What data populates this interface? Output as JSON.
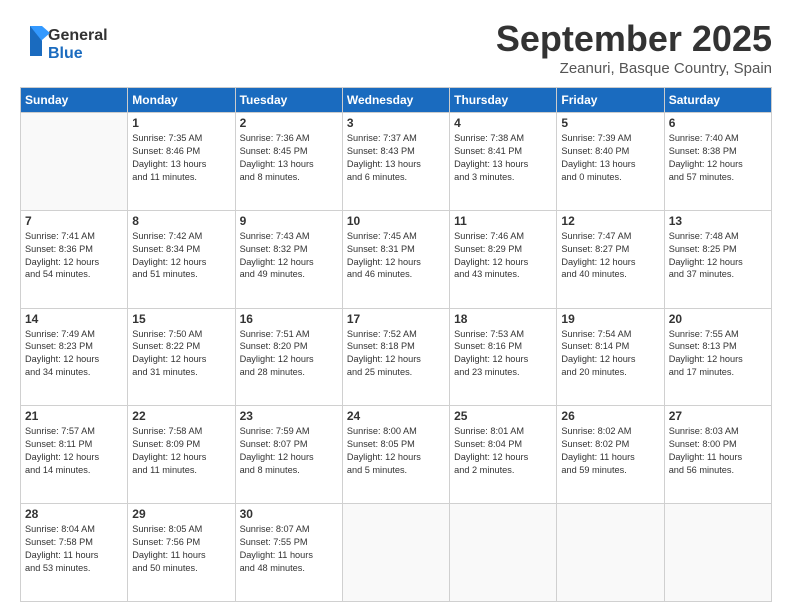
{
  "header": {
    "logo_general": "General",
    "logo_blue": "Blue",
    "month": "September 2025",
    "location": "Zeanuri, Basque Country, Spain"
  },
  "weekdays": [
    "Sunday",
    "Monday",
    "Tuesday",
    "Wednesday",
    "Thursday",
    "Friday",
    "Saturday"
  ],
  "weeks": [
    [
      {
        "day": "",
        "info": ""
      },
      {
        "day": "1",
        "info": "Sunrise: 7:35 AM\nSunset: 8:46 PM\nDaylight: 13 hours\nand 11 minutes."
      },
      {
        "day": "2",
        "info": "Sunrise: 7:36 AM\nSunset: 8:45 PM\nDaylight: 13 hours\nand 8 minutes."
      },
      {
        "day": "3",
        "info": "Sunrise: 7:37 AM\nSunset: 8:43 PM\nDaylight: 13 hours\nand 6 minutes."
      },
      {
        "day": "4",
        "info": "Sunrise: 7:38 AM\nSunset: 8:41 PM\nDaylight: 13 hours\nand 3 minutes."
      },
      {
        "day": "5",
        "info": "Sunrise: 7:39 AM\nSunset: 8:40 PM\nDaylight: 13 hours\nand 0 minutes."
      },
      {
        "day": "6",
        "info": "Sunrise: 7:40 AM\nSunset: 8:38 PM\nDaylight: 12 hours\nand 57 minutes."
      }
    ],
    [
      {
        "day": "7",
        "info": "Sunrise: 7:41 AM\nSunset: 8:36 PM\nDaylight: 12 hours\nand 54 minutes."
      },
      {
        "day": "8",
        "info": "Sunrise: 7:42 AM\nSunset: 8:34 PM\nDaylight: 12 hours\nand 51 minutes."
      },
      {
        "day": "9",
        "info": "Sunrise: 7:43 AM\nSunset: 8:32 PM\nDaylight: 12 hours\nand 49 minutes."
      },
      {
        "day": "10",
        "info": "Sunrise: 7:45 AM\nSunset: 8:31 PM\nDaylight: 12 hours\nand 46 minutes."
      },
      {
        "day": "11",
        "info": "Sunrise: 7:46 AM\nSunset: 8:29 PM\nDaylight: 12 hours\nand 43 minutes."
      },
      {
        "day": "12",
        "info": "Sunrise: 7:47 AM\nSunset: 8:27 PM\nDaylight: 12 hours\nand 40 minutes."
      },
      {
        "day": "13",
        "info": "Sunrise: 7:48 AM\nSunset: 8:25 PM\nDaylight: 12 hours\nand 37 minutes."
      }
    ],
    [
      {
        "day": "14",
        "info": "Sunrise: 7:49 AM\nSunset: 8:23 PM\nDaylight: 12 hours\nand 34 minutes."
      },
      {
        "day": "15",
        "info": "Sunrise: 7:50 AM\nSunset: 8:22 PM\nDaylight: 12 hours\nand 31 minutes."
      },
      {
        "day": "16",
        "info": "Sunrise: 7:51 AM\nSunset: 8:20 PM\nDaylight: 12 hours\nand 28 minutes."
      },
      {
        "day": "17",
        "info": "Sunrise: 7:52 AM\nSunset: 8:18 PM\nDaylight: 12 hours\nand 25 minutes."
      },
      {
        "day": "18",
        "info": "Sunrise: 7:53 AM\nSunset: 8:16 PM\nDaylight: 12 hours\nand 23 minutes."
      },
      {
        "day": "19",
        "info": "Sunrise: 7:54 AM\nSunset: 8:14 PM\nDaylight: 12 hours\nand 20 minutes."
      },
      {
        "day": "20",
        "info": "Sunrise: 7:55 AM\nSunset: 8:13 PM\nDaylight: 12 hours\nand 17 minutes."
      }
    ],
    [
      {
        "day": "21",
        "info": "Sunrise: 7:57 AM\nSunset: 8:11 PM\nDaylight: 12 hours\nand 14 minutes."
      },
      {
        "day": "22",
        "info": "Sunrise: 7:58 AM\nSunset: 8:09 PM\nDaylight: 12 hours\nand 11 minutes."
      },
      {
        "day": "23",
        "info": "Sunrise: 7:59 AM\nSunset: 8:07 PM\nDaylight: 12 hours\nand 8 minutes."
      },
      {
        "day": "24",
        "info": "Sunrise: 8:00 AM\nSunset: 8:05 PM\nDaylight: 12 hours\nand 5 minutes."
      },
      {
        "day": "25",
        "info": "Sunrise: 8:01 AM\nSunset: 8:04 PM\nDaylight: 12 hours\nand 2 minutes."
      },
      {
        "day": "26",
        "info": "Sunrise: 8:02 AM\nSunset: 8:02 PM\nDaylight: 11 hours\nand 59 minutes."
      },
      {
        "day": "27",
        "info": "Sunrise: 8:03 AM\nSunset: 8:00 PM\nDaylight: 11 hours\nand 56 minutes."
      }
    ],
    [
      {
        "day": "28",
        "info": "Sunrise: 8:04 AM\nSunset: 7:58 PM\nDaylight: 11 hours\nand 53 minutes."
      },
      {
        "day": "29",
        "info": "Sunrise: 8:05 AM\nSunset: 7:56 PM\nDaylight: 11 hours\nand 50 minutes."
      },
      {
        "day": "30",
        "info": "Sunrise: 8:07 AM\nSunset: 7:55 PM\nDaylight: 11 hours\nand 48 minutes."
      },
      {
        "day": "",
        "info": ""
      },
      {
        "day": "",
        "info": ""
      },
      {
        "day": "",
        "info": ""
      },
      {
        "day": "",
        "info": ""
      }
    ]
  ]
}
